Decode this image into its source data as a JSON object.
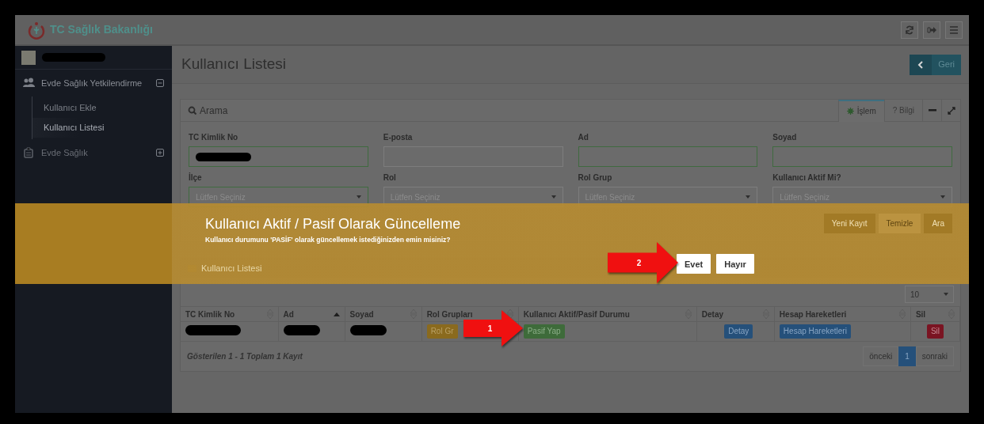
{
  "header": {
    "brand": "TC Sağlık Bakanlığı"
  },
  "sidebar": {
    "user": {
      "redacted": true
    },
    "items": [
      {
        "label": "Evde Sağlık Yetkilendirme",
        "expanded": true,
        "children": [
          {
            "label": "Kullanıcı Ekle",
            "selected": false
          },
          {
            "label": "Kullanıcı Listesi",
            "selected": true
          }
        ]
      },
      {
        "label": "Evde Sağlık",
        "expanded": false
      }
    ]
  },
  "page": {
    "title": "Kullanıcı Listesi",
    "back_button": "Geri"
  },
  "search_panel": {
    "title": "Arama",
    "tabs": [
      {
        "label": "İşlem",
        "selected": true
      },
      {
        "label": "? Bilgi",
        "selected": false
      }
    ],
    "fields": [
      {
        "label": "TC Kimlik No",
        "kind": "input",
        "valid": true,
        "redacted": true
      },
      {
        "label": "E-posta",
        "kind": "input",
        "valid": false,
        "redacted": false
      },
      {
        "label": "Ad",
        "kind": "input",
        "valid": true,
        "redacted": false
      },
      {
        "label": "Soyad",
        "kind": "input",
        "valid": true,
        "redacted": false
      },
      {
        "label": "İlçe",
        "kind": "select",
        "valid": true,
        "placeholder": "Lütfen Seçiniz"
      },
      {
        "label": "Rol",
        "kind": "select",
        "valid": false,
        "placeholder": "Lütfen Seçiniz"
      },
      {
        "label": "Rol Grup",
        "kind": "select",
        "valid": false,
        "placeholder": "Lütfen Seçiniz"
      },
      {
        "label": "Kullanıcı Aktif Mi?",
        "kind": "select",
        "valid": false,
        "placeholder": "Lütfen Seçiniz"
      }
    ],
    "buttons": [
      "Yeni Kayıt",
      "Temizle",
      "Ara"
    ]
  },
  "list_panel": {
    "title": "Kullanıcı Listesi",
    "page_size": "10",
    "columns": [
      {
        "label": "TC Kimlik No",
        "sorted_ascending": false
      },
      {
        "label": "Ad",
        "sorted_ascending": true
      },
      {
        "label": "Soyad",
        "sorted_ascending": false
      },
      {
        "label": "Rol Grupları",
        "sorted_ascending": false
      },
      {
        "label": "Kullanıcı Aktif/Pasif Durumu",
        "sorted_ascending": false
      },
      {
        "label": "Detay",
        "sorted_ascending": false
      },
      {
        "label": "Hesap Hareketleri",
        "sorted_ascending": false
      },
      {
        "label": "Sil",
        "sorted_ascending": false
      }
    ],
    "rows": [
      [
        {
          "kind": "redacted"
        },
        {
          "kind": "redacted"
        },
        {
          "kind": "redacted"
        },
        {
          "kind": "button",
          "text": "Rol Gr"
        },
        {
          "kind": "button",
          "text": "Pasif Yap"
        },
        {
          "kind": "button",
          "text": "Detay"
        },
        {
          "kind": "button",
          "text": "Hesap Hareketleri"
        },
        {
          "kind": "button",
          "text": "Sil"
        }
      ]
    ],
    "footer": "Gösterilen 1 - 1 Toplam 1 Kayıt",
    "pagination": [
      {
        "label": "önceki",
        "selected": false
      },
      {
        "label": "1",
        "selected": true
      },
      {
        "label": "sonraki",
        "selected": false
      }
    ]
  },
  "modal": {
    "title": "Kullanıcı Aktif / Pasif Olarak Güncelleme",
    "message": "Kullanıcı durumunu 'PASİF' olarak güncellemek istediğinizden emin misiniz?",
    "buttons": [
      "Evet",
      "Hayır"
    ]
  },
  "annotations": [
    {
      "label": "1"
    },
    {
      "label": "2"
    }
  ]
}
